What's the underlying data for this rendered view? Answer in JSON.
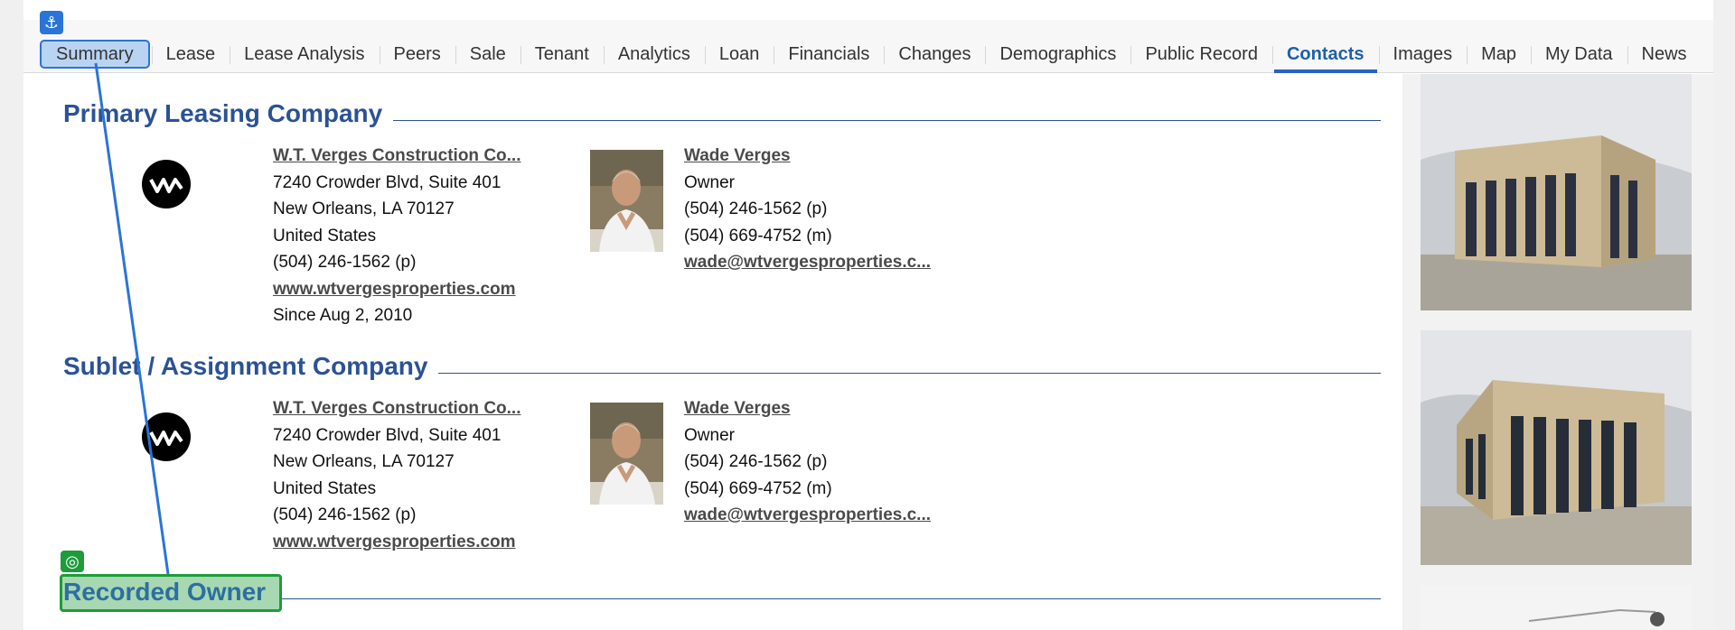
{
  "tabs": [
    {
      "label": "Summary"
    },
    {
      "label": "Lease"
    },
    {
      "label": "Lease Analysis"
    },
    {
      "label": "Peers"
    },
    {
      "label": "Sale"
    },
    {
      "label": "Tenant"
    },
    {
      "label": "Analytics"
    },
    {
      "label": "Loan"
    },
    {
      "label": "Financials"
    },
    {
      "label": "Changes"
    },
    {
      "label": "Demographics"
    },
    {
      "label": "Public Record"
    },
    {
      "label": "Contacts"
    },
    {
      "label": "Images"
    },
    {
      "label": "Map"
    },
    {
      "label": "My Data"
    },
    {
      "label": "News"
    }
  ],
  "active_tab": "Contacts",
  "sections": [
    {
      "title": "Primary Leasing Company",
      "company": {
        "name": "W.T. Verges Construction Co...",
        "address1": "7240 Crowder Blvd, Suite 401",
        "address2": "New Orleans, LA 70127",
        "country": "United States",
        "phone": "(504) 246-1562 (p)",
        "website": "www.wtvergesproperties.com",
        "since": "Since Aug 2, 2010"
      },
      "contact": {
        "name": "Wade Verges",
        "role": "Owner",
        "phone": "(504) 246-1562 (p)",
        "mobile": "(504) 669-4752 (m)",
        "email": "wade@wtvergesproperties.c..."
      }
    },
    {
      "title": "Sublet / Assignment Company",
      "company": {
        "name": "W.T. Verges Construction Co...",
        "address1": "7240 Crowder Blvd, Suite 401",
        "address2": "New Orleans, LA 70127",
        "country": "United States",
        "phone": "(504) 246-1562 (p)",
        "website": "www.wtvergesproperties.com"
      },
      "contact": {
        "name": "Wade Verges",
        "role": "Owner",
        "phone": "(504) 246-1562 (p)",
        "mobile": "(504) 669-4752 (m)",
        "email": "wade@wtvergesproperties.c..."
      }
    },
    {
      "title": "Recorded Owner"
    }
  ],
  "overlay": {
    "anchor_icon": "anchor-icon",
    "target_icon": "target-icon",
    "anchor_glyph": "⚓",
    "target_glyph": "◎",
    "colors": {
      "anchor": "#2a74d8",
      "target": "#1e9c3a"
    }
  },
  "colors": {
    "section_title": "#2b5294",
    "active_tab": "#1f5fa8"
  }
}
